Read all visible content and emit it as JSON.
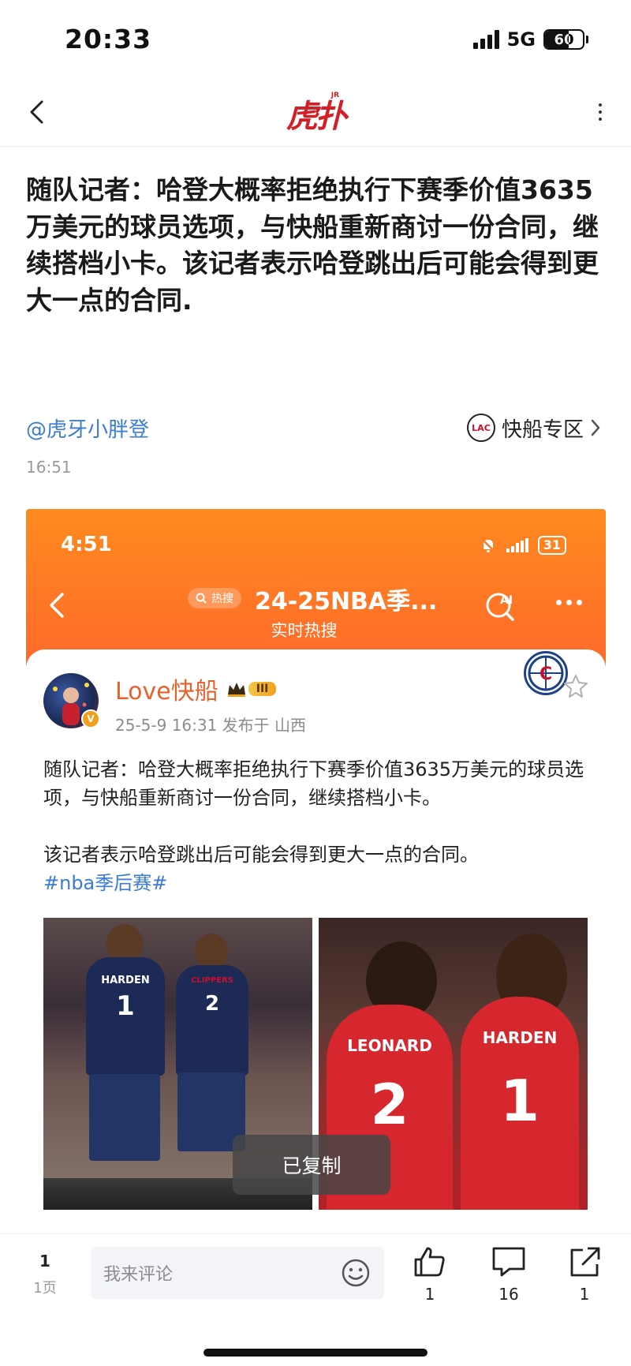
{
  "status": {
    "time": "20:33",
    "network": "5G",
    "battery": "60"
  },
  "nav": {
    "logo": "虎扑",
    "logo_sup": "JR"
  },
  "article": {
    "headline": "随队记者：哈登大概率拒绝执行下赛季价值3635万美元的球员选项，与快船重新商讨一份合同，继续搭档小卡。该记者表示哈登跳出后可能会得到更大一点的合同.",
    "author": "@虎牙小胖登",
    "zone_label": "快船专区",
    "zone_logo": "LAC",
    "time": "16:51"
  },
  "embed": {
    "status_time": "4:51",
    "battery": "31",
    "search_chip": "热搜",
    "title": "24-25NBA季...",
    "subtitle": "实时热搜",
    "ai_label": "AI",
    "username": "Love快船",
    "vip_level": "III",
    "avatar_badge": "V",
    "post_meta": "25-5-9 16:31  发布于 山西",
    "paragraph1": "随队记者：哈登大概率拒绝执行下赛季价值3635万美元的球员选项，与快船重新商讨一份合同，继续搭档小卡。",
    "paragraph2": "该记者表示哈登跳出后可能会得到更大一点的合同。",
    "hashtag": "#nba季后赛#",
    "team_logo": "C",
    "photo_left": {
      "player1_name": "HARDEN",
      "player1_num": "1",
      "player2_name": "CLIPPERS",
      "player2_num": "2"
    },
    "photo_right": {
      "player1_name": "LEONARD",
      "player1_num": "2",
      "player2_name": "HARDEN",
      "player2_num": "1"
    }
  },
  "toast": "已复制",
  "bottom": {
    "page_num": "1",
    "page_total": "1页",
    "comment_placeholder": "我来评论",
    "like_count": "1",
    "comment_count": "16",
    "share_count": "1"
  }
}
